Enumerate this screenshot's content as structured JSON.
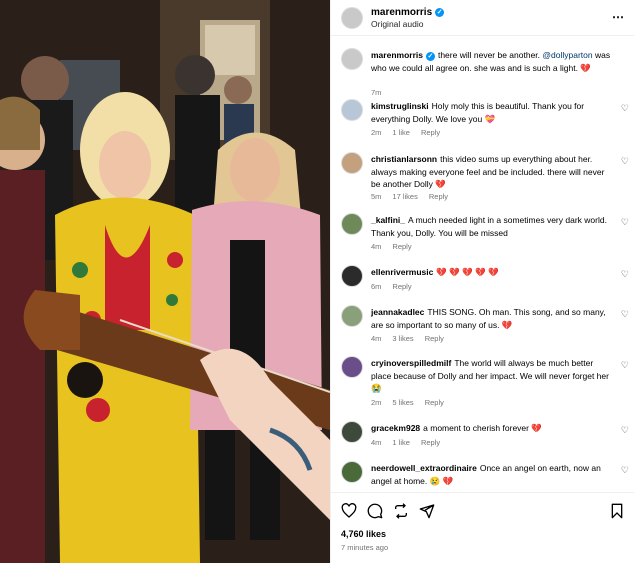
{
  "post": {
    "username": "marenmorris",
    "audio": "Original audio",
    "more_icon": "more-dots-icon"
  },
  "caption": {
    "username": "marenmorris",
    "text_before": "there will never be another.",
    "mention": "@dollyparton",
    "text_after": "was who we could all agree on. she was and is such a light.",
    "emoji": "💔",
    "time": "7m"
  },
  "comments": [
    {
      "username": "kimstruglinski",
      "text": "Holy moly this is beautiful. Thank you for everything Dolly. We love you",
      "emoji": "💝",
      "time": "2m",
      "likes": "1 like",
      "reply": "Reply"
    },
    {
      "username": "christianlarsonn",
      "text": "this video sums up everything about her. always making everyone feel and be included. there will never be another Dolly",
      "emoji": "💔",
      "time": "5m",
      "likes": "17 likes",
      "reply": "Reply"
    },
    {
      "username": "_kalfini_",
      "text": "A much needed light in a sometimes very dark world. Thank you, Dolly. You will be missed",
      "emoji": "",
      "time": "4m",
      "likes": "",
      "reply": "Reply"
    },
    {
      "username": "ellenrivermusic",
      "text": "",
      "emoji": "💔 💔 💔 💔 💔",
      "time": "6m",
      "likes": "",
      "reply": "Reply"
    },
    {
      "username": "jeannakadlec",
      "text": "THIS SONG. Oh man. This song, and so many, are so important to so many of us.",
      "emoji": "💔",
      "time": "4m",
      "likes": "3 likes",
      "reply": "Reply"
    },
    {
      "username": "cryinoverspilledmilf",
      "text": "The world will always be much better place because of Dolly and her impact. We will never forget her",
      "emoji": "😭",
      "time": "2m",
      "likes": "5 likes",
      "reply": "Reply"
    },
    {
      "username": "gracekm928",
      "text": "a moment to cherish forever",
      "emoji": "💔",
      "time": "4m",
      "likes": "1 like",
      "reply": "Reply"
    },
    {
      "username": "neerdowell_extraordinaire",
      "text": "Once an angel on earth, now an angel at home.",
      "emoji": "😢 💔",
      "time": "",
      "likes": "",
      "reply": ""
    }
  ],
  "footer": {
    "likes": "4,760 likes",
    "time_ago": "7 minutes ago",
    "icons": [
      "heart-icon",
      "comment-icon",
      "share-icon",
      "send-icon",
      "bookmark-icon"
    ]
  },
  "colors": {
    "link": "#00376b",
    "verified": "#0095f6",
    "heart_broken": "#ed4956",
    "muted": "#737373"
  }
}
